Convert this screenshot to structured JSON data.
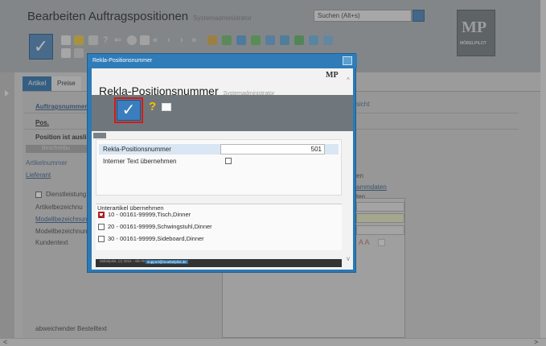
{
  "app": {
    "title": "Bearbeiten Auftragspositionen",
    "user": "Systemadministrator",
    "search_placeholder": "Suchen (Alt+s)",
    "logo_mark": "MP",
    "logo_name": "MÖBELPILOT",
    "tabs": [
      "Artikel",
      "Preise"
    ],
    "labels": {
      "auftragsnummer": "Auftragsnummer",
      "pos": "Pos.",
      "position_status": "Position ist auslie",
      "beschreibung": "Beschreibu",
      "artikelnummer": "Artikelnummer",
      "lieferant": "Lieferant",
      "dienstleistung": "Dienstleistung",
      "artikelbezeichnung": "Artikelbezeichnu",
      "modellbezeichnung1": "Modellbezeichnung",
      "modellbezeichnung2": "Modellbezeichnung",
      "kundentext": "Kundentext",
      "abweichender_bestelltext": "abweichender Bestelltext",
      "right_sicht": "sicht",
      "right_en": "en",
      "right_stammdaten": "ammdaten",
      "right_ten": "ten"
    }
  },
  "modal": {
    "window_title": "Rekla-Positionsnummer",
    "title": "Rekla-Positionsnummer",
    "user": "Systemadministrator",
    "logo_mark": "MP",
    "form": {
      "rekla_label": "Rekla-Positionsnummer",
      "rekla_value": "501",
      "internal_text_label": "Interner Text übernehmen",
      "internal_text_checked": false
    },
    "sub_articles": {
      "header": "Unterartikel übernehmen",
      "items": [
        {
          "text": "10 - 00161-99999,Tisch,Dinner",
          "checked": true
        },
        {
          "text": "20 - 00161-99999,Schwingstuhl,Dinner",
          "checked": false
        },
        {
          "text": "30 - 00161-99999,Sideboard,Dinner",
          "checked": false
        }
      ]
    },
    "footer_text": "Möbelpilot, (c) 2015 - Alle Rechte",
    "footer_link": "support@moebelpilot.de"
  },
  "colors": {
    "modal_blue": "#2b79b5",
    "highlight_red": "#d11a1a",
    "help_yellow": "#f2c200"
  }
}
